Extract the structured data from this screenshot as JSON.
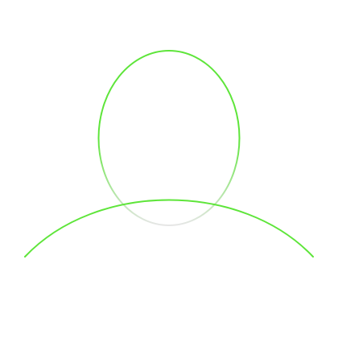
{
  "icon": {
    "name": "user-avatar-outline-icon",
    "colors": {
      "background": "#ffffff",
      "stroke_bright": "#5ee53a",
      "stroke_faded": "#e6e6e6"
    }
  }
}
